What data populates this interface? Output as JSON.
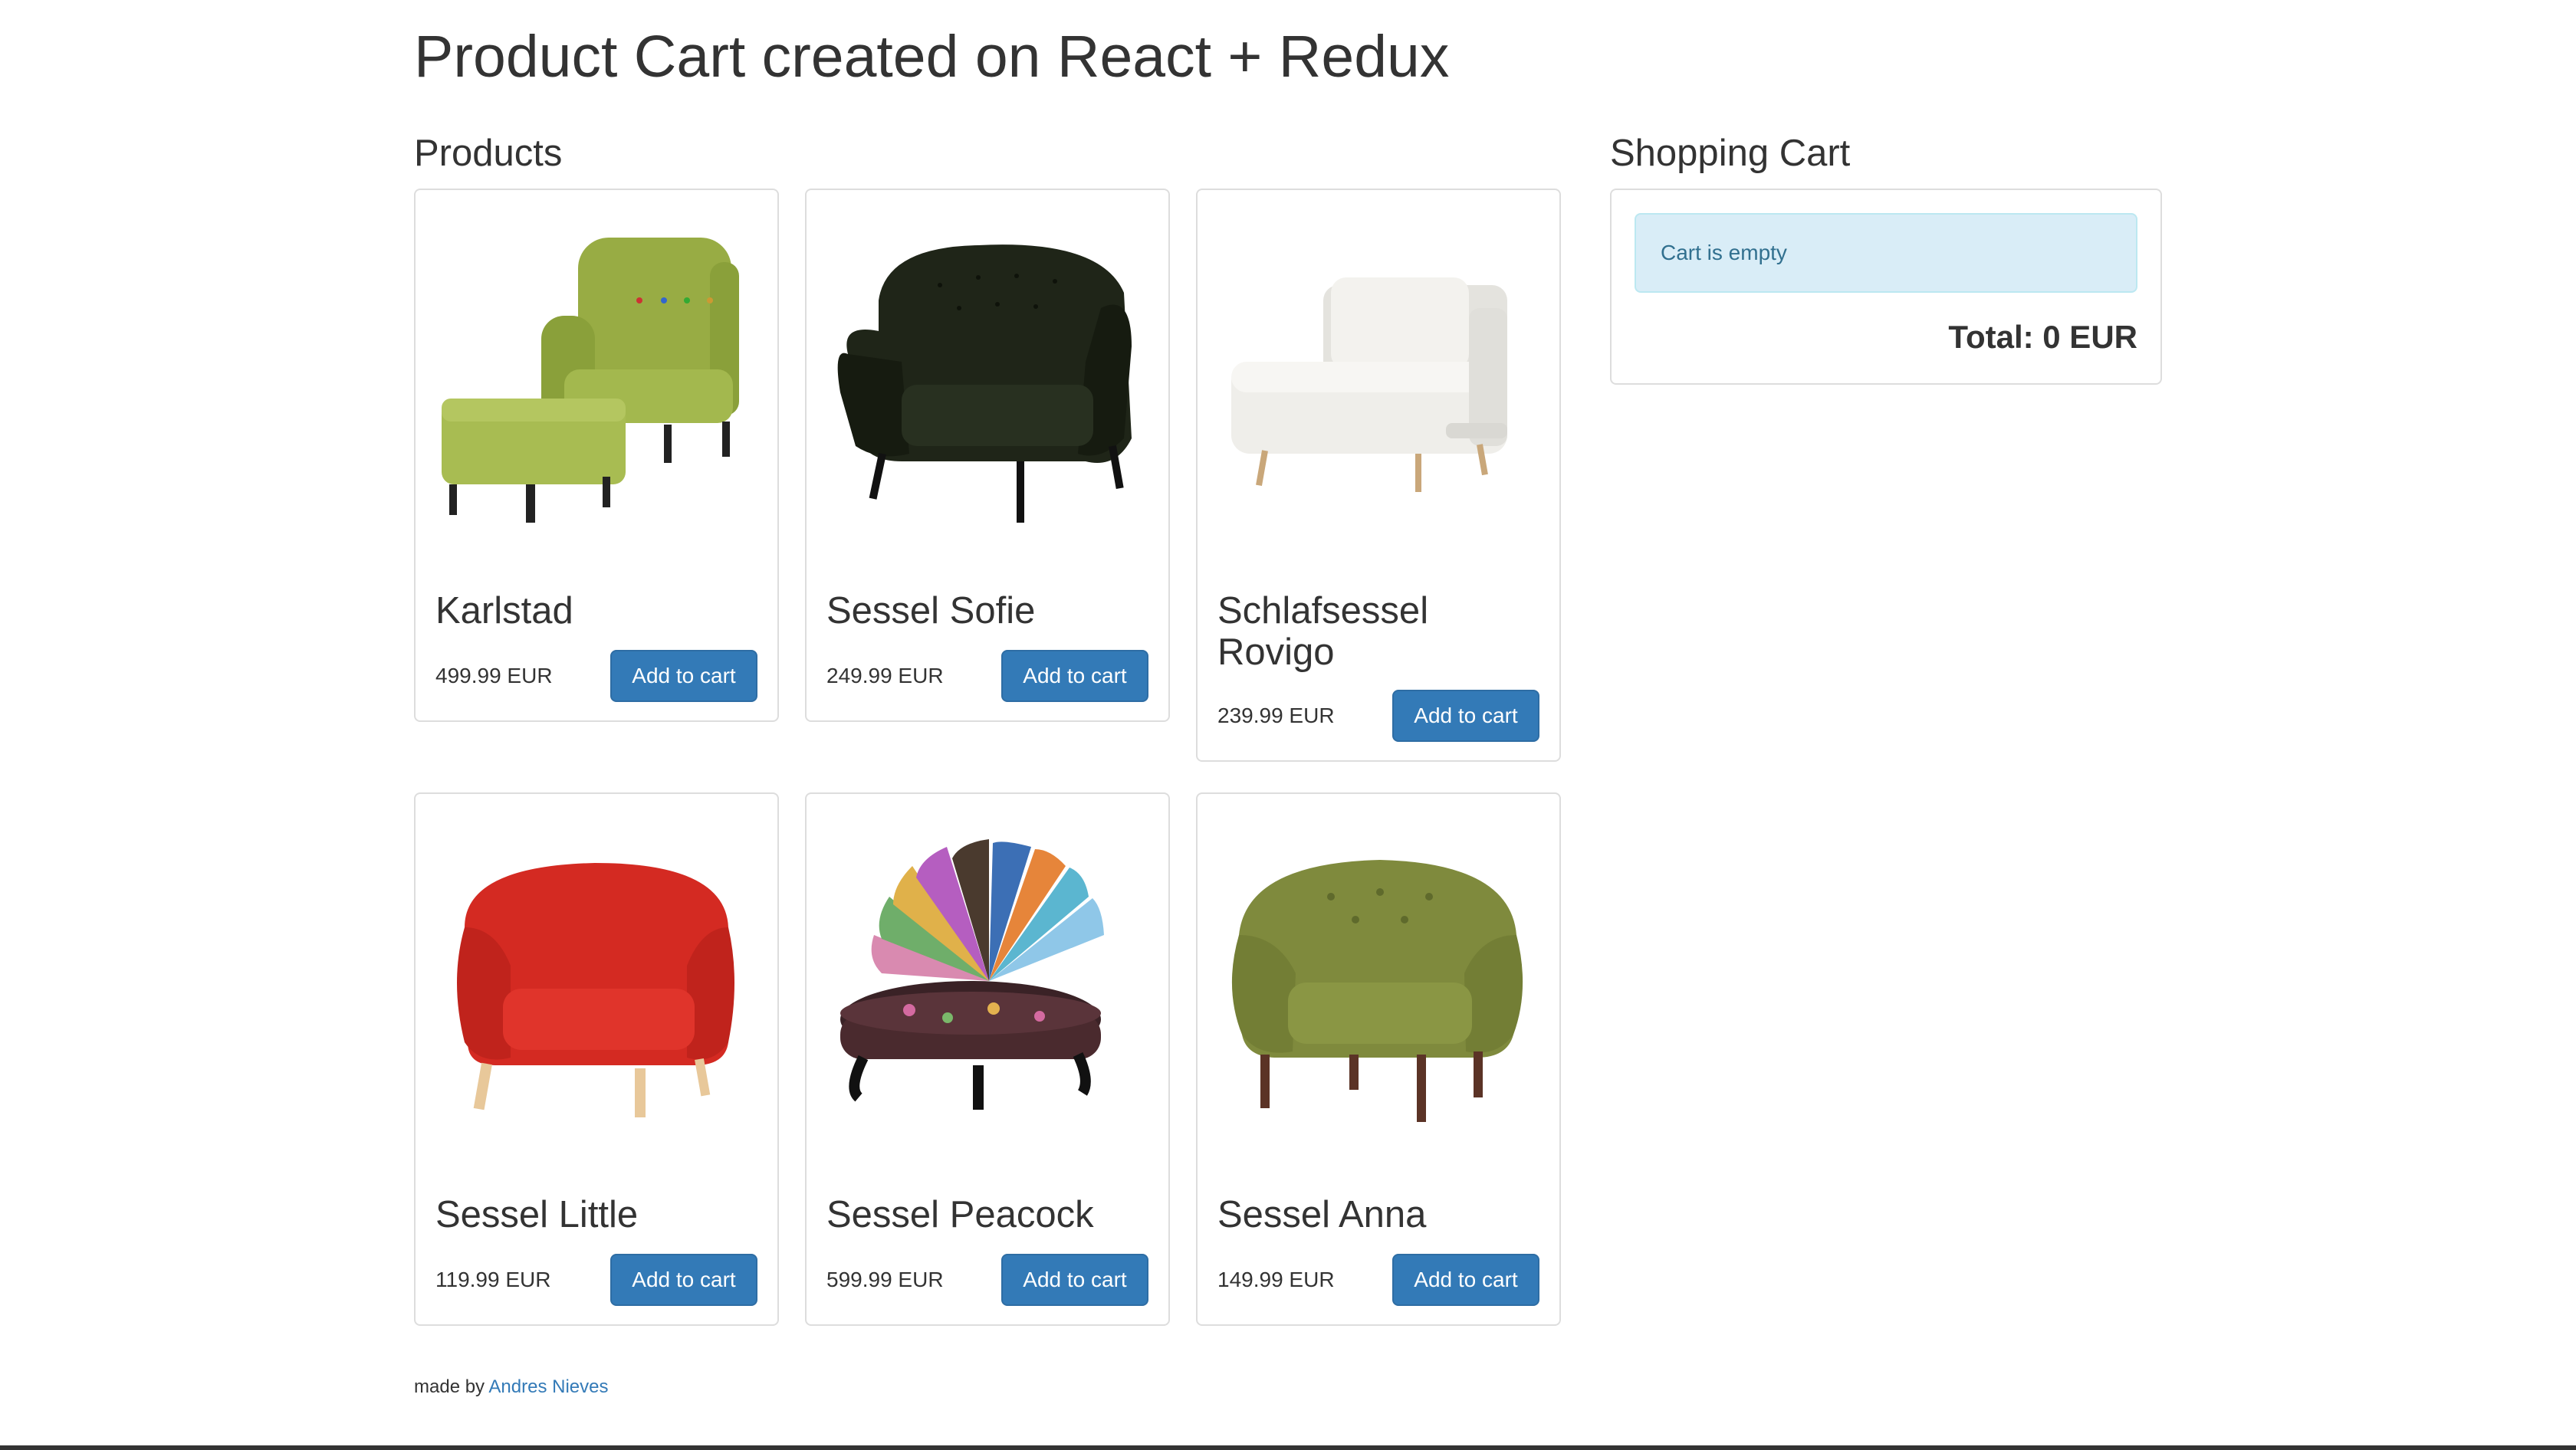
{
  "header": {
    "title": "Product Cart created on React + Redux"
  },
  "products_section": {
    "title": "Products"
  },
  "products": [
    {
      "name": "Karlstad",
      "price": "499.99 EUR",
      "button": "Add to cart",
      "icon": "armchair-with-ottoman-image",
      "color": "#98ac44"
    },
    {
      "name": "Sessel Sofie",
      "price": "249.99 EUR",
      "button": "Add to cart",
      "icon": "tufted-armchair-image",
      "color": "#1f2518"
    },
    {
      "name": "Schlafsessel Rovigo",
      "price": "239.99 EUR",
      "button": "Add to cart",
      "icon": "sleeper-chair-image",
      "color": "#efeeea"
    },
    {
      "name": "Sessel Little",
      "price": "119.99 EUR",
      "button": "Add to cart",
      "icon": "tub-chair-image",
      "color": "#d42a22"
    },
    {
      "name": "Sessel Peacock",
      "price": "599.99 EUR",
      "button": "Add to cart",
      "icon": "peacock-chair-image",
      "color": "#4a2a2e"
    },
    {
      "name": "Sessel Anna",
      "price": "149.99 EUR",
      "button": "Add to cart",
      "icon": "tub-chair-image",
      "color": "#7f8a3d"
    }
  ],
  "cart": {
    "title": "Shopping Cart",
    "empty_message": "Cart is empty",
    "total": "Total: 0 EUR"
  },
  "footer": {
    "prefix": "made by",
    "author": "Andres Nieves"
  }
}
